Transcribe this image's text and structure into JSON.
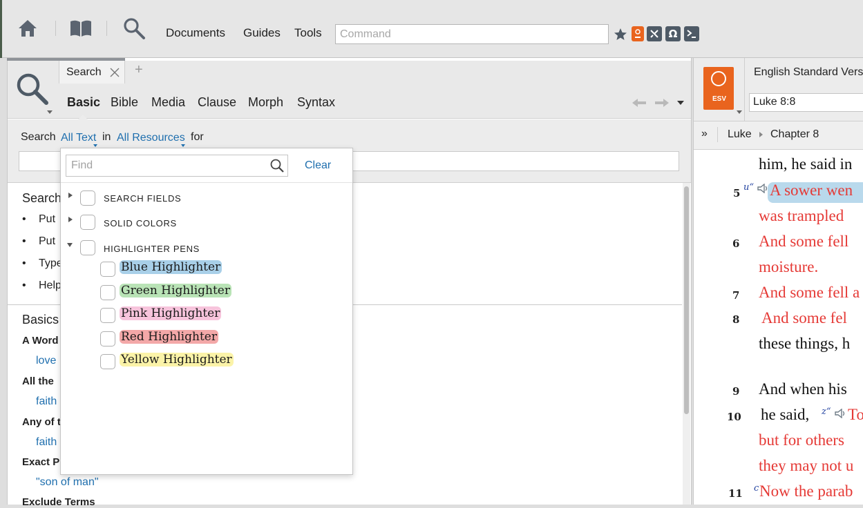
{
  "toolbar": {
    "nav": [
      "Documents",
      "Guides",
      "Tools"
    ],
    "command_placeholder": "Command",
    "icons": [
      "home-icon",
      "library-icon",
      "search-icon",
      "star-icon",
      "layout-icon",
      "tool-icon",
      "omega-icon",
      "console-icon"
    ]
  },
  "search_panel": {
    "tab_label": "Search",
    "new_tab": "+",
    "types": [
      "Basic",
      "Bible",
      "Media",
      "Clause",
      "Morph",
      "Syntax"
    ],
    "active_type": "Basic",
    "form": {
      "search_label": "Search",
      "scope": "All Text",
      "in_label": "in",
      "resources": "All Resources",
      "for_label": "for"
    },
    "help": {
      "title": "Search",
      "lines": [
        "Put",
        "Put",
        "Type",
        "Help"
      ]
    },
    "basics": {
      "title": "Basics",
      "items": [
        {
          "label": "A Word",
          "example": "love"
        },
        {
          "label": "All the",
          "example": "faith"
        },
        {
          "label": "Any of t",
          "example": "faith"
        },
        {
          "label": "Exact P",
          "example": "\"son of man\""
        },
        {
          "label": "Exclude Terms",
          "example": ""
        }
      ]
    }
  },
  "dropdown": {
    "find_placeholder": "Find",
    "clear_label": "Clear",
    "categories": [
      {
        "label": "SEARCH FIELDS",
        "expanded": false
      },
      {
        "label": "SOLID COLORS",
        "expanded": false
      },
      {
        "label": "HIGHLIGHTER PENS",
        "expanded": true
      }
    ],
    "highlighters": [
      {
        "label": "Blue Highlighter",
        "color": "#a8cfe8"
      },
      {
        "label": "Green Highlighter",
        "color": "#b9e3b6"
      },
      {
        "label": "Pink Highlighter",
        "color": "#f7c4dc"
      },
      {
        "label": "Red Highlighter",
        "color": "#f3a8a8"
      },
      {
        "label": "Yellow Highlighter",
        "color": "#fbf3a8"
      }
    ]
  },
  "bible_panel": {
    "version": "English Standard Vers",
    "badge": "ESV",
    "reference": "Luke 8:8",
    "breadcrumb": {
      "expand": "»",
      "book": "Luke",
      "chapter": "Chapter 8"
    },
    "lines": [
      {
        "verse": "",
        "text": "him, he said in",
        "red": false
      },
      {
        "verse": "5",
        "text": "A sower wen",
        "red": true,
        "marker": "u“",
        "highlight": "#b9d9ec"
      },
      {
        "verse": "",
        "text": "was trampled",
        "red": true
      },
      {
        "verse": "6",
        "text": "And some fell",
        "red": true
      },
      {
        "verse": "",
        "text": "moisture.",
        "red": true
      },
      {
        "verse": "7",
        "text": "And some fell a",
        "red": true
      },
      {
        "verse": "8",
        "text": "And some fel",
        "red": true
      },
      {
        "verse": "",
        "text": "these things, h",
        "red": false
      },
      {
        "verse": "9",
        "text": "And when his",
        "red": false
      },
      {
        "verse": "10",
        "text": "he said,",
        "red": false,
        "marker": "z“",
        "after": "To"
      },
      {
        "verse": "",
        "text": "but for others",
        "red": true
      },
      {
        "verse": "",
        "text": "they may not u",
        "red": true
      },
      {
        "verse": "11",
        "text": "Now the parab",
        "red": true,
        "marker": "c"
      }
    ]
  },
  "colors": {
    "accent": "#1f6fae",
    "words_of_christ": "#e53935",
    "esv_orange": "#e9641e"
  }
}
